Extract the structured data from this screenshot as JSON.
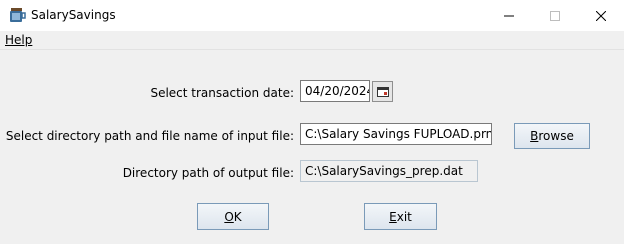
{
  "window": {
    "title": "SalarySavings"
  },
  "menu": {
    "help": "Help"
  },
  "form": {
    "date_label": "Select transaction date:",
    "date_value": "04/20/2024",
    "input_label": "Select directory path and file name of input file:",
    "input_value": "C:\\Salary Savings FUPLOAD.prn",
    "output_label": "Directory path of output file:",
    "output_value": "C:\\SalarySavings_prep.dat"
  },
  "buttons": {
    "browse_first": "B",
    "browse_rest": "rowse",
    "ok_first": "O",
    "ok_rest": "K",
    "exit_first": "E",
    "exit_rest": "xit"
  }
}
